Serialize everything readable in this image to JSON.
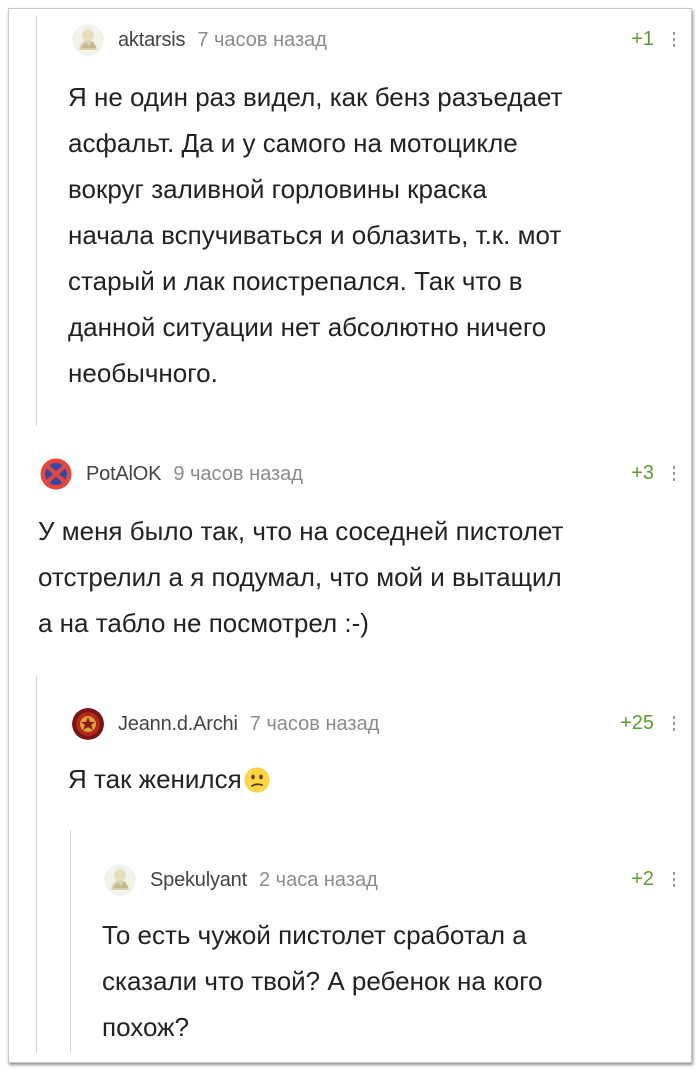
{
  "comments": [
    {
      "username": "aktarsis",
      "time": "7 часов назад",
      "rating": "+1",
      "avatar": "default-avatar-icon",
      "lines": [
        "Я не один раз видел, как бенз разъедает",
        "асфальт. Да и у самого на мотоцикле",
        "вокруг заливной горловины краска",
        "начала вспучиваться и облазить, т.к. мот",
        "старый и лак поистрепался. Так что в",
        "данной ситуации нет абсолютно ничего",
        "необычного."
      ]
    },
    {
      "username": "PotAlOK",
      "time": "9 часов назад",
      "rating": "+3",
      "avatar": "no-entry-sign-icon",
      "lines": [
        "У меня было так, что на соседней пистолет",
        "отстрелил а я подумал, что мой и вытащил",
        "а на табло не посмотрел :-)"
      ]
    },
    {
      "username": "Jeann.d.Archi",
      "time": "7 часов назад",
      "rating": "+25",
      "avatar": "emblem-avatar-icon",
      "lines": [
        "Я так женился"
      ],
      "emoji": "confused-face-emoji"
    },
    {
      "username": "Spekulyant",
      "time": "2 часа назад",
      "rating": "+2",
      "avatar": "default-avatar-icon",
      "lines": [
        "То есть чужой пистолет сработал а",
        "сказали что твой? А ребенок на кого",
        "похож?"
      ]
    }
  ],
  "colors": {
    "rating": "#5a9f2e",
    "time": "#8c8c8c",
    "username": "#444444",
    "text": "#222222",
    "thread_line": "#d4d4d4"
  }
}
